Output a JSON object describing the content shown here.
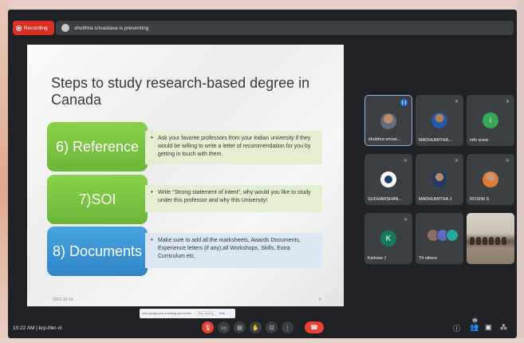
{
  "recording": {
    "label": "Recording"
  },
  "presenting": {
    "text": "shubhra srivastava is presenting"
  },
  "slide": {
    "title": "Steps to study research-based degree in Canada",
    "steps": [
      {
        "label": "6) Reference",
        "text": "Ask your favorite professors from your Indian university if they would be willing to write a letter of recommendation for you by getting in touch with them."
      },
      {
        "label": "7)SOI",
        "text": "Write “Strong statement of intent”, why would you like to study under this professor and why this University!"
      },
      {
        "label": "8) Documents",
        "text": "Make sure to add all the marksheets, Awards Documents, Experience letters (if any),all Workshops, Skills, Extra Curriculum etc."
      }
    ],
    "date": "2022-10-14",
    "page": "5"
  },
  "share_bar": {
    "text": "meet.google.com is sharing your screen.",
    "stop_label": "Stop sharing",
    "hide_label": "Hide"
  },
  "participants": [
    {
      "name": "shubhra srivas...",
      "speaking": true
    },
    {
      "name": "MADHUMITHA..."
    },
    {
      "name": "info vcew",
      "initial": "i"
    },
    {
      "name": "SUDHARSHAN..."
    },
    {
      "name": "MADHUMITHA J"
    },
    {
      "name": "ROSINI S"
    },
    {
      "name": "Kishore J",
      "initial": "K"
    },
    {
      "name": "74 others"
    }
  ],
  "bottom": {
    "time": "10:22 AM",
    "separator": "|",
    "meeting_code": "krp-ihkr-rii",
    "participant_count": "85"
  },
  "colors": {
    "record_red": "#d93025",
    "step_green": "#7cc242",
    "step_blue": "#3b95d6",
    "end_call": "#ea4335"
  },
  "icons": [
    "record-icon",
    "presenter-avatar",
    "mic-off-icon",
    "camera-icon",
    "captions-icon",
    "raise-hand-icon",
    "present-icon",
    "more-options-icon",
    "end-call-icon",
    "info-icon",
    "people-icon",
    "chat-icon",
    "activities-icon"
  ]
}
